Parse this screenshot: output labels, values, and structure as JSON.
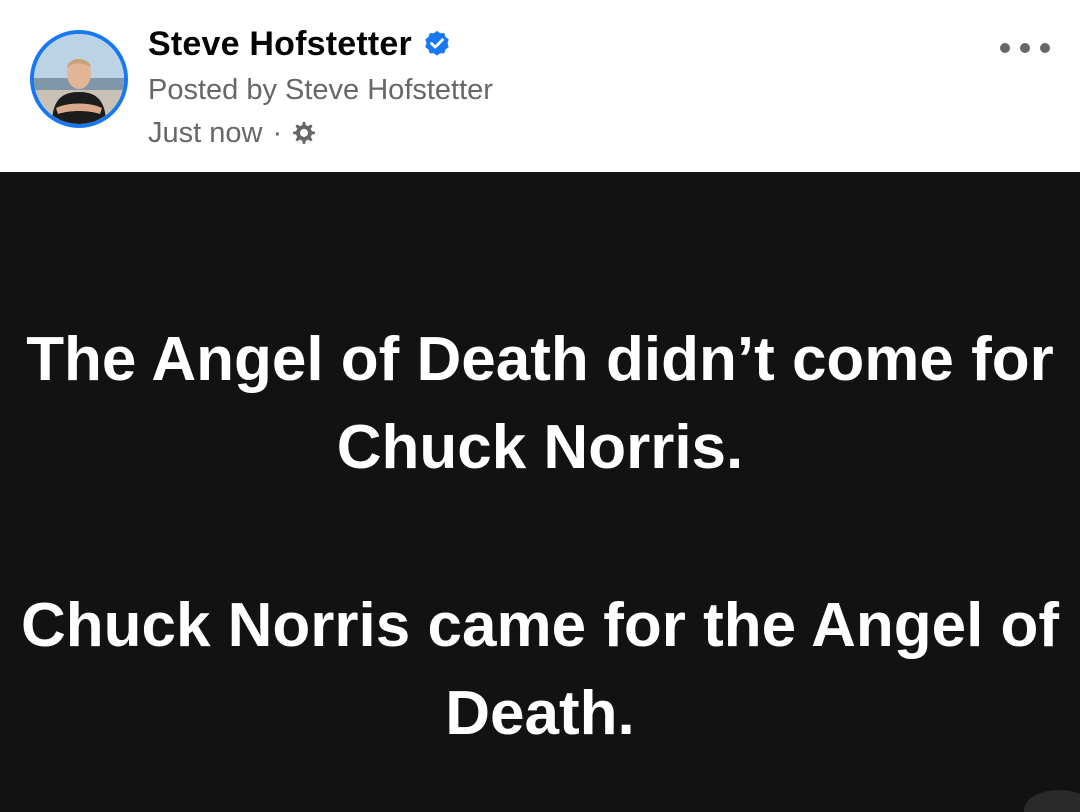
{
  "post": {
    "author": "Steve Hofstetter",
    "verified": true,
    "posted_by": "Posted by Steve Hofstetter",
    "timestamp": "Just now",
    "separator": "·",
    "audience_icon": "gear-icon",
    "text_paragraphs": [
      "The Angel of Death didn’t come for Chuck Norris.",
      "Chuck Norris came for the Angel of Death."
    ]
  },
  "colors": {
    "accent": "#1877f2",
    "post_background": "#121212",
    "post_text": "#ffffff",
    "secondary_text": "#65676b"
  }
}
